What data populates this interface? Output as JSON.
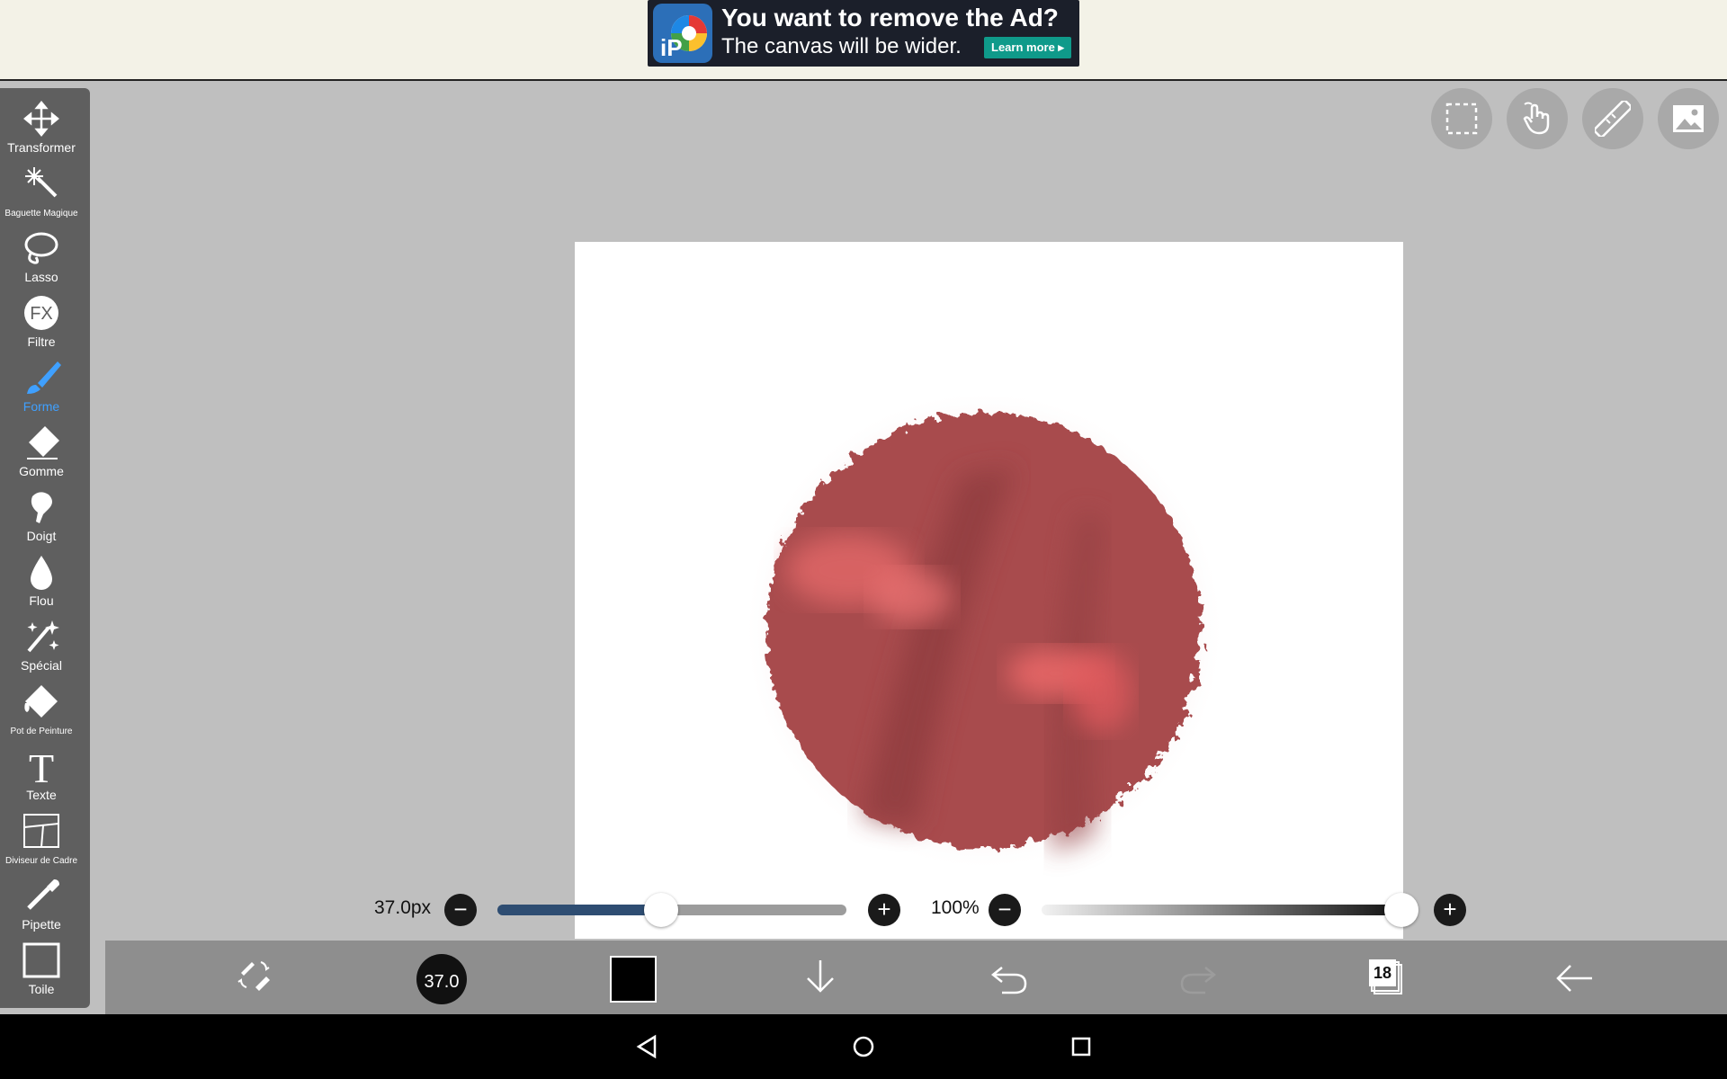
{
  "ad": {
    "title": "You want to remove the Ad?",
    "subtitle": "The canvas will be wider.",
    "button": "Learn more ▸",
    "logo_text": "iP"
  },
  "sidebar": {
    "items": [
      {
        "label": "Transformer",
        "icon": "move-icon"
      },
      {
        "label": "Baguette Magique",
        "icon": "magic-wand-icon"
      },
      {
        "label": "Lasso",
        "icon": "lasso-icon"
      },
      {
        "label": "Filtre",
        "icon": "fx-icon",
        "glyph": "FX"
      },
      {
        "label": "Forme",
        "icon": "brush-icon",
        "active": true
      },
      {
        "label": "Gomme",
        "icon": "eraser-icon"
      },
      {
        "label": "Doigt",
        "icon": "finger-icon"
      },
      {
        "label": "Flou",
        "icon": "blur-drop-icon"
      },
      {
        "label": "Spécial",
        "icon": "sparkle-icon"
      },
      {
        "label": "Pot de Peinture",
        "icon": "paint-bucket-icon"
      },
      {
        "label": "Texte",
        "icon": "text-icon",
        "glyph": "T"
      },
      {
        "label": "Diviseur de Cadre",
        "icon": "frame-divider-icon"
      },
      {
        "label": "Pipette",
        "icon": "eyedropper-icon"
      },
      {
        "label": "Toile",
        "icon": "canvas-icon"
      }
    ]
  },
  "topbar": {
    "buttons": [
      "selection-icon",
      "hand-icon",
      "ruler-icon",
      "image-icon"
    ]
  },
  "brush": {
    "size_label": "37.0px",
    "size_fraction": 0.47,
    "opacity_label": "100%",
    "opacity_fraction": 1.0,
    "preview_label": "37.0"
  },
  "toolbar": {
    "layers_count": "18",
    "items": [
      "swap-tool-icon",
      "brush-preview",
      "color-swatch",
      "download-icon",
      "undo-icon",
      "redo-icon",
      "layers-icon",
      "back-arrow-icon"
    ]
  },
  "colors": {
    "accent": "#3fa0ff",
    "paint": "#b04a4a",
    "slider_fill": "#2e4d72"
  }
}
